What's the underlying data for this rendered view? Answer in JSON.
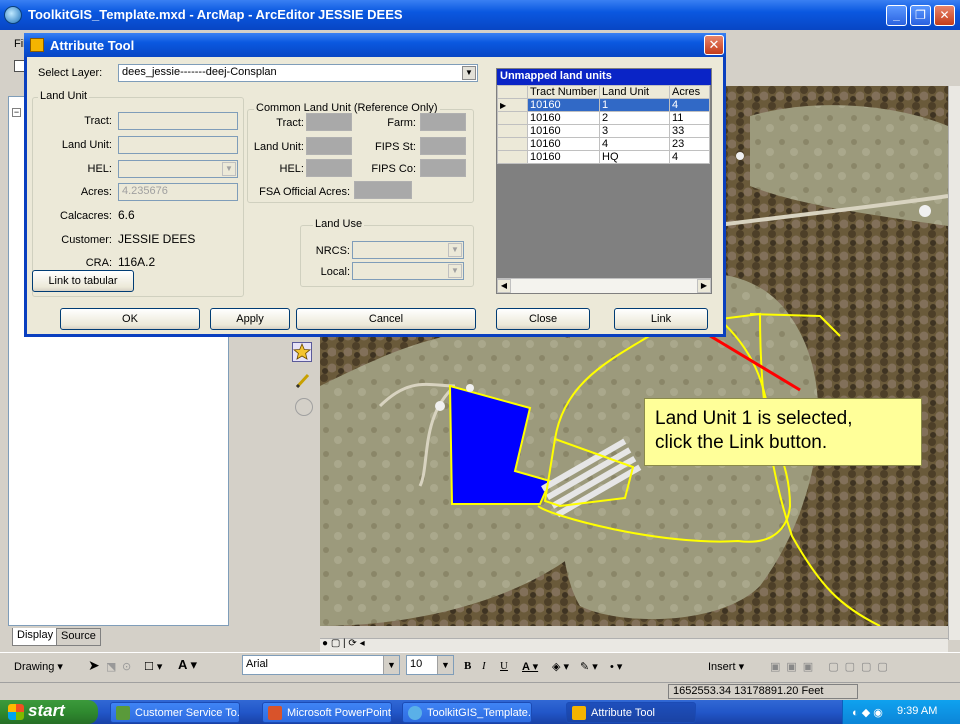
{
  "app": {
    "title": "ToolkitGIS_Template.mxd - ArcMap - ArcEditor",
    "owner": "JESSIE DEES",
    "menu_first": "Fil"
  },
  "toc": {
    "tab_display": "Display",
    "tab_source": "Source"
  },
  "dialog": {
    "title": "Attribute Tool",
    "select_layer_label": "Select Layer:",
    "select_layer_value": "dees_jessie-------deej-Consplan",
    "land_unit_group": "Land Unit",
    "tract_label": "Tract:",
    "land_unit_label": "Land Unit:",
    "hel_label": "HEL:",
    "acres_label": "Acres:",
    "acres_value": "4.235676",
    "calcacres_label": "Calcacres:",
    "calcacres_value": "6.6",
    "customer_label": "Customer:",
    "customer_value": "JESSIE DEES",
    "cra_label": "CRA:",
    "cra_value": "116A.2",
    "link_tabular": "Link to tabular",
    "clu_group": "Common Land Unit (Reference Only)",
    "clu_tract": "Tract:",
    "clu_farm": "Farm:",
    "clu_land_unit": "Land Unit:",
    "clu_fips_st": "FIPS St:",
    "clu_hel": "HEL:",
    "clu_fips_co": "FIPS Co:",
    "clu_fsa_acres": "FSA Official Acres:",
    "land_use_group": "Land Use",
    "nrcs_label": "NRCS:",
    "local_label": "Local:",
    "btn_ok": "OK",
    "btn_apply": "Apply",
    "btn_cancel": "Cancel",
    "btn_close": "Close",
    "btn_link": "Link",
    "grid": {
      "caption": "Unmapped land units",
      "columns": [
        "Tract Number",
        "Land Unit",
        "Acres"
      ],
      "rows": [
        {
          "tract": "10160",
          "unit": "1",
          "acres": "4"
        },
        {
          "tract": "10160",
          "unit": "2",
          "acres": "11"
        },
        {
          "tract": "10160",
          "unit": "3",
          "acres": "33"
        },
        {
          "tract": "10160",
          "unit": "4",
          "acres": "23"
        },
        {
          "tract": "10160",
          "unit": "HQ",
          "acres": "4"
        }
      ]
    }
  },
  "callout": {
    "line1": "Land Unit 1 is selected,",
    "line2": "click the Link button."
  },
  "drawing": {
    "drawing_label": "Drawing",
    "font_name": "Arial",
    "font_size": "10",
    "insert_label": "Insert"
  },
  "status": {
    "coordinates": "1652553.34 13178891.20 Feet"
  },
  "taskbar": {
    "start": "start",
    "tasks": [
      "Customer Service To...",
      "Microsoft PowerPoint ...",
      "ToolkitGIS_Template....",
      "Attribute Tool"
    ],
    "clock": "9:39 AM"
  },
  "colors": {
    "selection_fill": "#0000ff",
    "boundary": "#ffff00",
    "callout_bg": "#ffff99",
    "arrow": "#ff0000",
    "grid_header": "#0a24c6"
  },
  "icons": [
    "search-icon",
    "star-icon",
    "pencil-icon",
    "circle-icon",
    "arrow-cursor-icon",
    "windows-logo-icon"
  ]
}
